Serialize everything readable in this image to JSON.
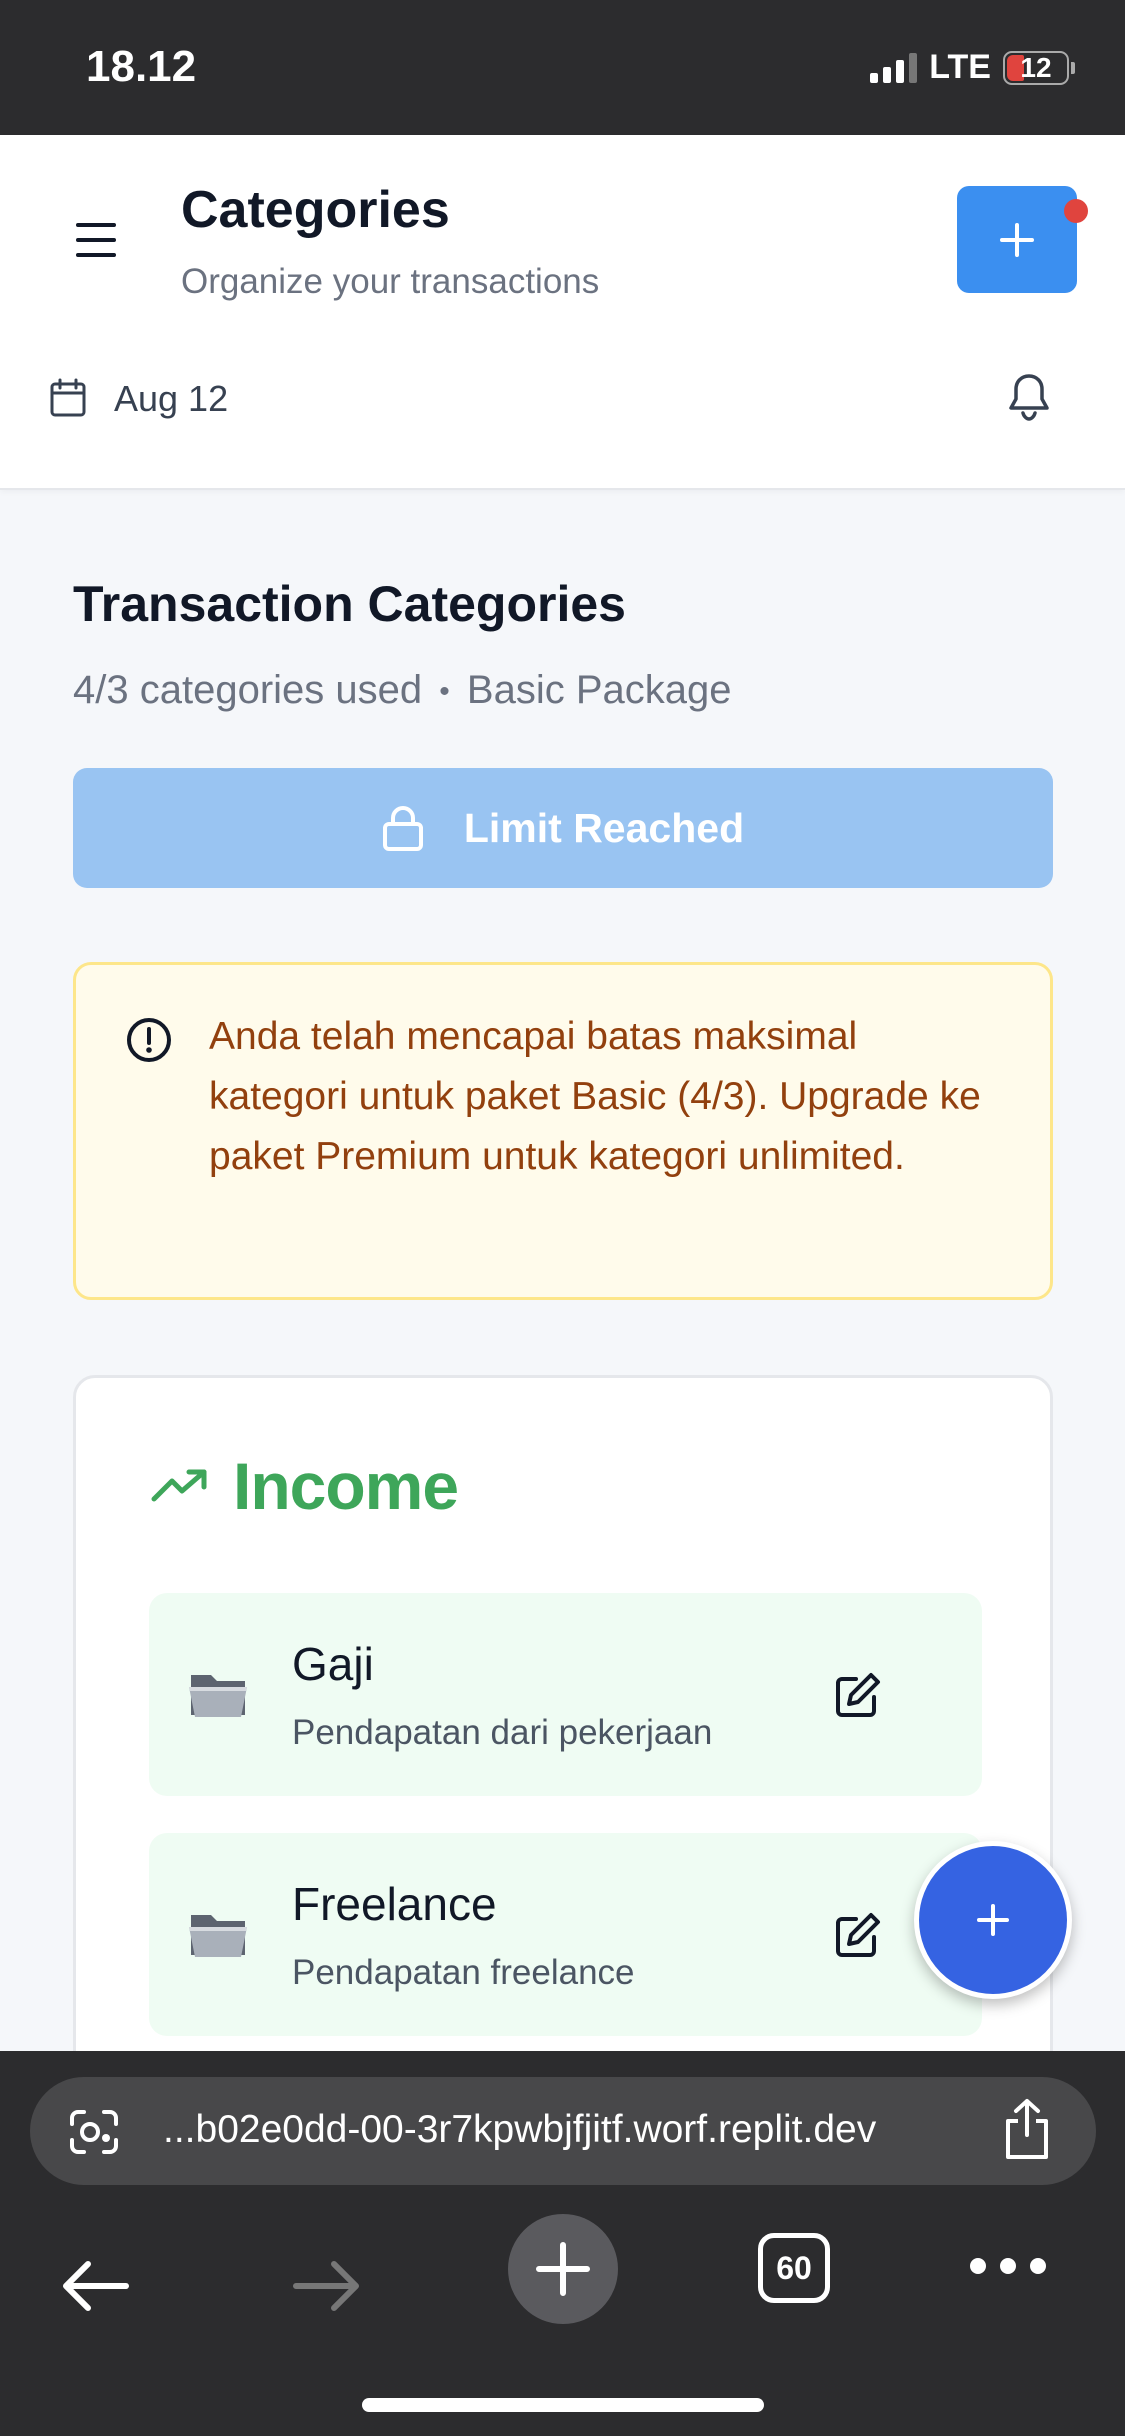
{
  "status_bar": {
    "time": "18.12",
    "network": "LTE",
    "battery": "12"
  },
  "header": {
    "title": "Categories",
    "subtitle": "Organize your transactions",
    "date": "Aug 12",
    "add_icon": "plus-icon",
    "menu_icon": "hamburger-icon",
    "calendar_icon": "calendar-icon",
    "bell_icon": "bell-icon"
  },
  "main": {
    "section_title": "Transaction Categories",
    "usage": "4/3 categories used",
    "separator": "•",
    "package": "Basic Package",
    "limit_button": "Limit Reached",
    "alert": "Anda telah mencapai batas maksimal kategori untuk paket Basic (4/3). Upgrade ke paket Premium untuk kategori unlimited."
  },
  "income": {
    "title": "Income",
    "items": [
      {
        "name": "Gaji",
        "description": "Pendapatan dari pekerjaan"
      },
      {
        "name": "Freelance",
        "description": "Pendapatan freelance"
      }
    ]
  },
  "browser": {
    "url": "...b02e0dd-00-3r7kpwbjfjitf.worf.replit.dev",
    "tab_count": "60"
  },
  "colors": {
    "primary": "#3b8ff0",
    "income_green": "#3ea65a",
    "fab": "#3563e2",
    "alert_text": "#92400e",
    "alert_bg": "#fffbeb"
  }
}
